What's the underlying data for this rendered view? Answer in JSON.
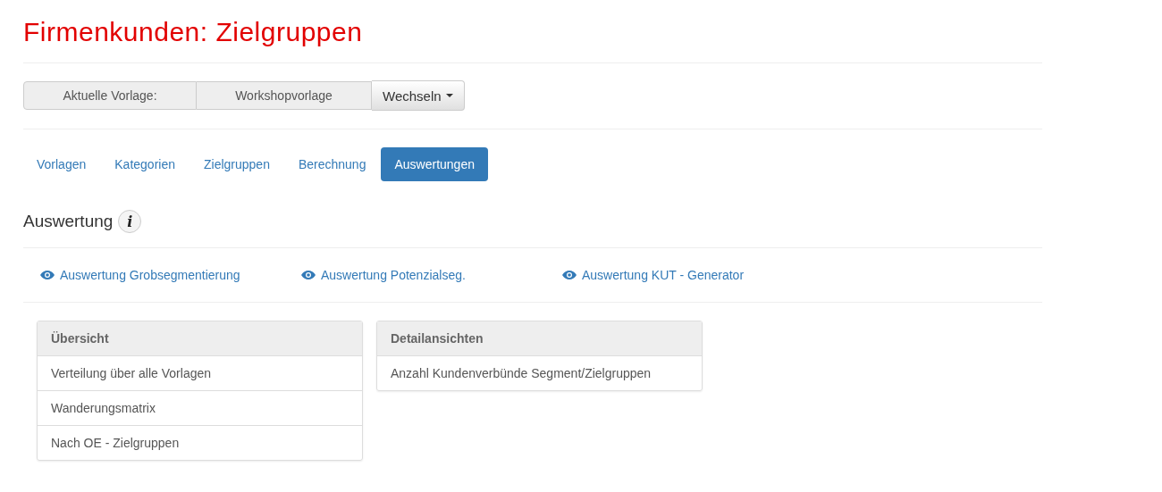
{
  "title": "Firmenkunden: Zielgruppen",
  "template_bar": {
    "label": "Aktuelle Vorlage:",
    "value": "Workshopvorlage",
    "button": "Wechseln"
  },
  "tabs": [
    {
      "label": "Vorlagen",
      "selected": false
    },
    {
      "label": "Kategorien",
      "selected": false
    },
    {
      "label": "Zielgruppen",
      "selected": false
    },
    {
      "label": "Berechnung",
      "selected": false
    },
    {
      "label": "Auswertungen",
      "selected": true
    }
  ],
  "section": {
    "heading": "Auswertung",
    "info_icon": "i"
  },
  "links": [
    "Auswertung Grobsegmentierung",
    "Auswertung Potenzialseg.",
    "Auswertung KUT - Generator"
  ],
  "panels": [
    {
      "heading": "Übersicht",
      "items": [
        "Verteilung über alle Vorlagen",
        "Wanderungsmatrix",
        "Nach OE - Zielgruppen"
      ]
    },
    {
      "heading": "Detailansichten",
      "items": [
        "Anzahl Kundenverbünde Segment/Zielgruppen"
      ]
    }
  ]
}
